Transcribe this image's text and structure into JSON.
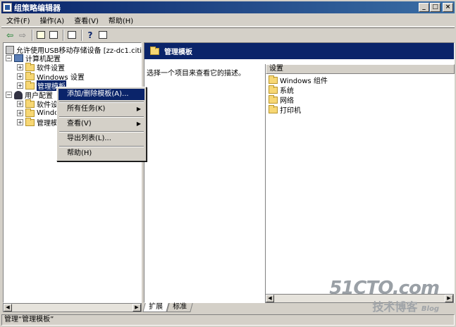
{
  "window": {
    "title": "组策略编辑器",
    "min_label": "_",
    "max_label": "□",
    "close_label": "×"
  },
  "menu": [
    "文件(F)",
    "操作(A)",
    "查看(V)",
    "帮助(H)"
  ],
  "tree": {
    "root": "允许使用USB移动存储设备 [zz-dc1.citi",
    "computer": "计算机配置",
    "computer_items": [
      "软件设置",
      "Windows 设置",
      "管理模板"
    ],
    "user": "用户配置",
    "user_items": [
      "软件设",
      "Window",
      "管理模"
    ]
  },
  "right": {
    "header": "管理模板",
    "description": "选择一个项目来查看它的描述。",
    "column_header": "设置",
    "items": [
      "Windows 组件",
      "系统",
      "网络",
      "打印机"
    ]
  },
  "context_menu": {
    "items": [
      "添加/删除模板(A)...",
      "所有任务(K)",
      "查看(V)",
      "导出列表(L)...",
      "帮助(H)"
    ],
    "highlighted": 0
  },
  "tabs": [
    "扩展",
    "标准"
  ],
  "status": "管理“管理模板”",
  "watermark": {
    "line1": "51CTO.com",
    "line2": "技术博客",
    "line3": "Blog"
  }
}
